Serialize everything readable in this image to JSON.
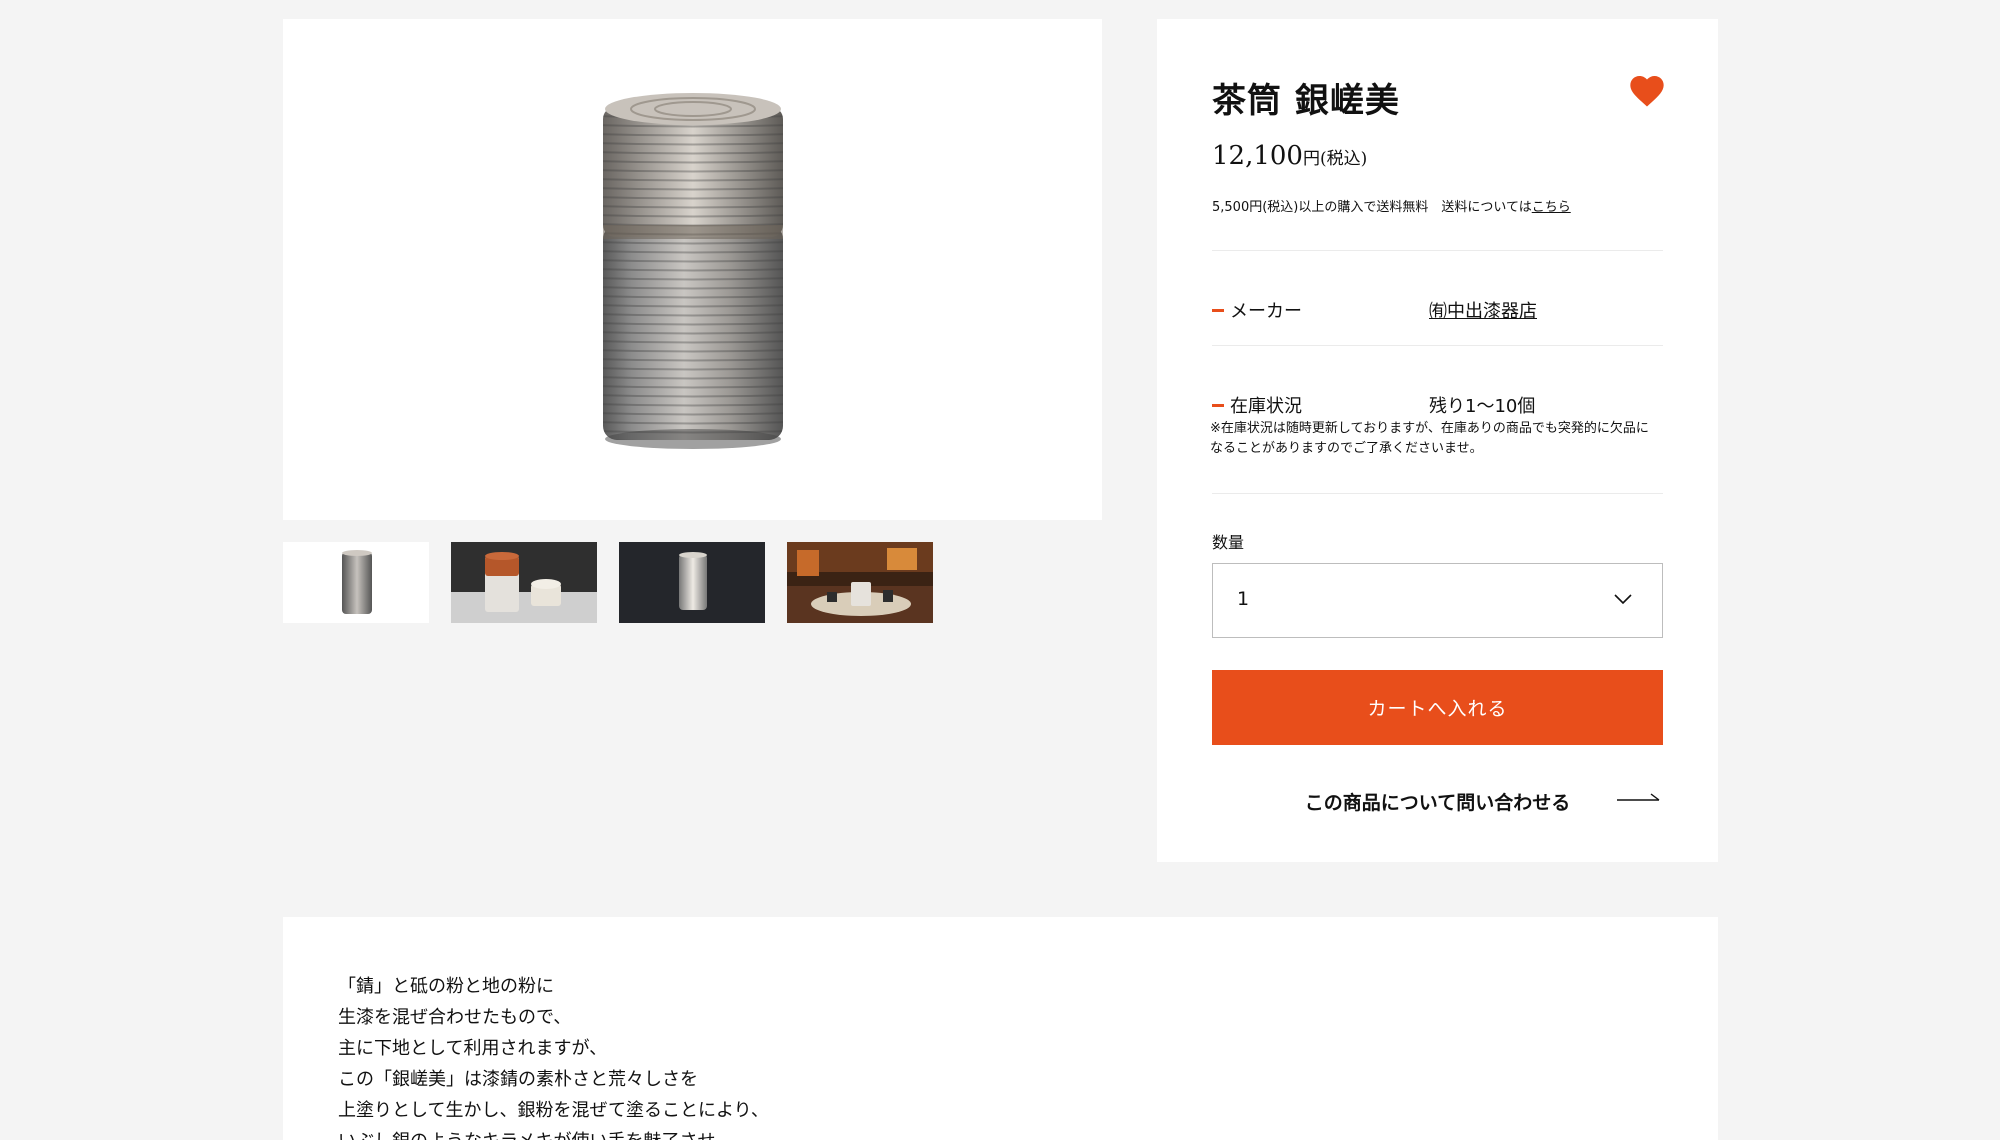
{
  "product": {
    "title": "茶筒 銀嵯美",
    "price_amount": "12,100",
    "price_suffix": "円(税込)",
    "shipping_text": "5,500円(税込)以上の購入で送料無料　送料については",
    "shipping_link": "こちら"
  },
  "specs": {
    "maker_label": "メーカー",
    "maker_value": "㈲中出漆器店",
    "stock_label": "在庫状況",
    "stock_value": "残り1〜10個",
    "stock_note": "※在庫状況は随時更新しておりますが、在庫ありの商品でも突発的に欠品になることがありますのでご了承くださいませ。"
  },
  "quantity": {
    "label": "数量",
    "selected": "1"
  },
  "actions": {
    "cart_label": "カートへ入れる",
    "inquiry_label": "この商品について問い合わせる"
  },
  "description": {
    "lines": [
      "「錆」と砥の粉と地の粉に",
      "生漆を混ぜ合わせたもので、",
      "主に下地として利用されますが、",
      "この「銀嵯美」は漆錆の素朴さと荒々しさを",
      "上塗りとして生かし、銀粉を混ぜて塗ることにより、",
      "いぶし銀のようなキラメキが使い手を魅了させ"
    ]
  },
  "colors": {
    "accent": "#e84e1b",
    "background": "#f4f4f4"
  },
  "icons": {
    "favorite": "heart-icon",
    "dropdown": "chevron-down-icon",
    "inquiry": "arrow-right-icon"
  }
}
